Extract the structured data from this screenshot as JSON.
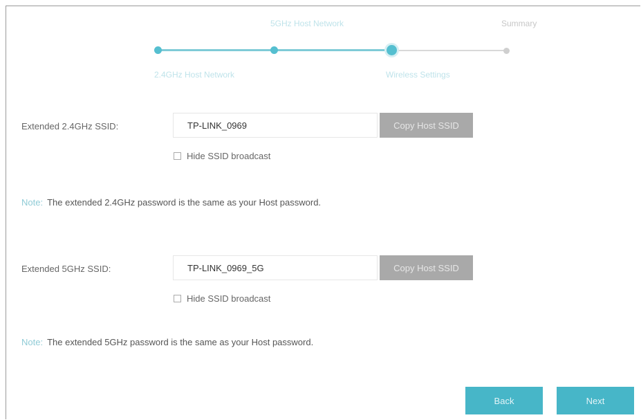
{
  "steps": {
    "items": [
      {
        "label": "2.4GHz Host Network",
        "state": "done"
      },
      {
        "label": "5GHz Host Network",
        "state": "done"
      },
      {
        "label": "Wireless Settings",
        "state": "current"
      },
      {
        "label": "Summary",
        "state": "pending"
      }
    ]
  },
  "form": {
    "ssid24": {
      "label": "Extended 2.4GHz SSID:",
      "value": "TP-LINK_0969",
      "copy_button": "Copy Host SSID",
      "hide_label": "Hide SSID broadcast",
      "hide_checked": false
    },
    "note24": {
      "prefix": "Note:",
      "text": "The extended 2.4GHz password is the same as your Host password."
    },
    "ssid5": {
      "label": "Extended 5GHz SSID:",
      "value": "TP-LINK_0969_5G",
      "copy_button": "Copy Host SSID",
      "hide_label": "Hide SSID broadcast",
      "hide_checked": false
    },
    "note5": {
      "prefix": "Note:",
      "text": "The extended 5GHz password is the same as your Host password."
    }
  },
  "footer": {
    "back_label": "Back",
    "next_label": "Next"
  },
  "colors": {
    "accent": "#47b6c8",
    "step_done": "#55bfd0",
    "step_pending": "#cfcfcf",
    "disabled_button": "#a9a9a9"
  }
}
